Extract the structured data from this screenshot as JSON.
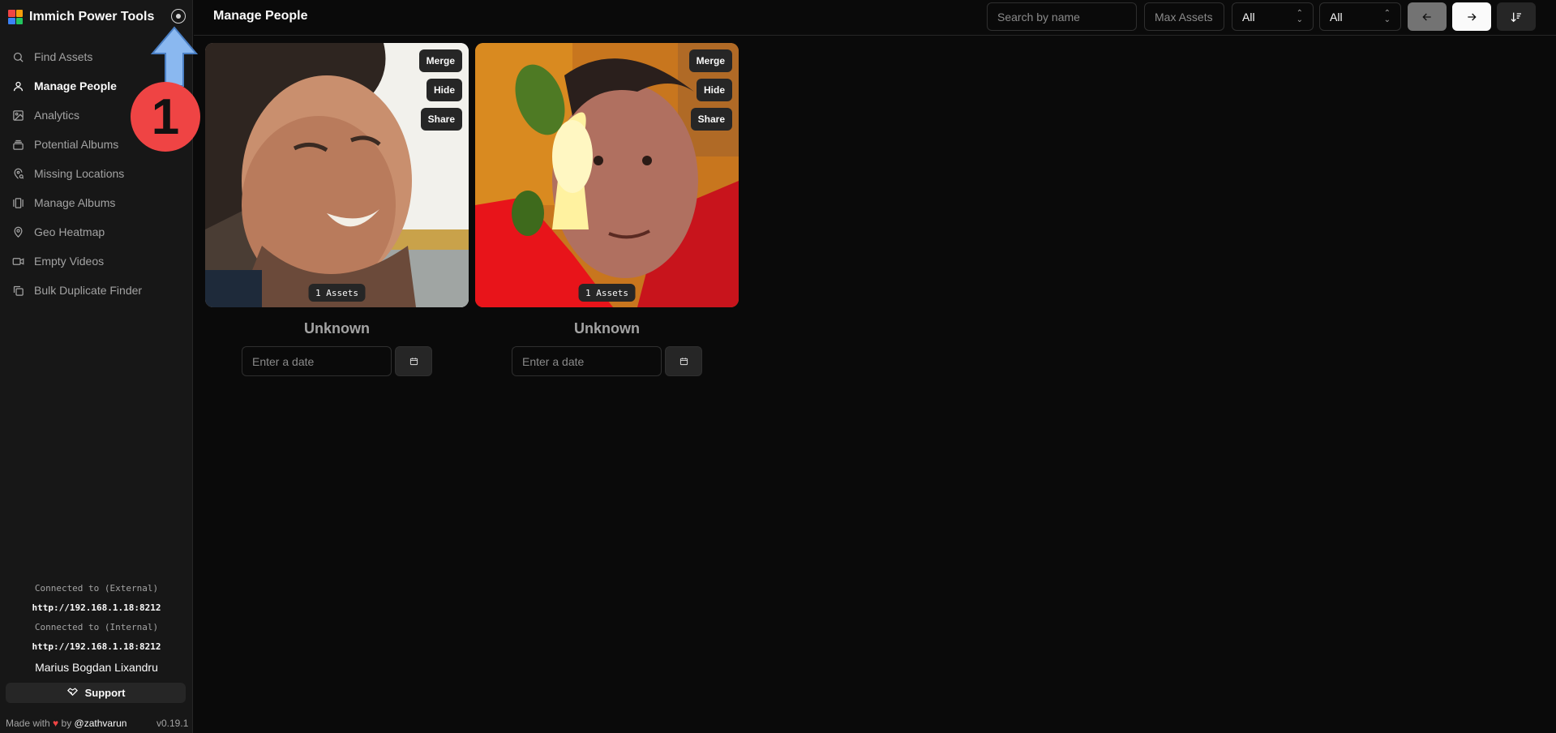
{
  "app": {
    "title": "Immich Power Tools",
    "logo_colors": [
      "#ef4444",
      "#f59e0b",
      "#3b82f6",
      "#22c55e"
    ],
    "theme_toggle_icon": "sun-moon-icon"
  },
  "sidebar": {
    "items": [
      {
        "label": "Find Assets",
        "icon": "search-icon",
        "active": false
      },
      {
        "label": "Manage People",
        "icon": "user-icon",
        "active": true
      },
      {
        "label": "Analytics",
        "icon": "image-chart-icon",
        "active": false
      },
      {
        "label": "Potential Albums",
        "icon": "album-stack-icon",
        "active": false
      },
      {
        "label": "Missing Locations",
        "icon": "location-search-icon",
        "active": false
      },
      {
        "label": "Manage Albums",
        "icon": "albums-icon",
        "active": false
      },
      {
        "label": "Geo Heatmap",
        "icon": "map-pin-icon",
        "active": false
      },
      {
        "label": "Empty Videos",
        "icon": "video-icon",
        "active": false
      },
      {
        "label": "Bulk Duplicate Finder",
        "icon": "copy-icon",
        "active": false
      }
    ],
    "connection": {
      "external_label": "Connected to (External)",
      "external_url": "http://192.168.1.18:8212",
      "internal_label": "Connected to (Internal)",
      "internal_url": "http://192.168.1.18:8212"
    },
    "user_name": "Marius Bogdan Lixandru",
    "support_label": "Support",
    "made_with_prefix": "Made with",
    "made_with_heart": "♥",
    "made_with_by": "by",
    "made_with_author": "@zathvarun",
    "version": "v0.19.1"
  },
  "annotation": {
    "number": "1",
    "arrow_color": "#8ab8f0",
    "circle_color": "#ef4444"
  },
  "header": {
    "title": "Manage People",
    "search_placeholder": "Search by name",
    "max_assets_placeholder": "Max Assets",
    "filter1_value": "All",
    "filter2_value": "All",
    "prev_icon": "arrow-left-icon",
    "next_icon": "arrow-right-icon",
    "sort_icon": "sort-icon"
  },
  "people": [
    {
      "name": "Unknown",
      "assets_label": "1 Assets",
      "merge_label": "Merge",
      "hide_label": "Hide",
      "share_label": "Share",
      "date_placeholder": "Enter a date"
    },
    {
      "name": "Unknown",
      "assets_label": "1 Assets",
      "merge_label": "Merge",
      "hide_label": "Hide",
      "share_label": "Share",
      "date_placeholder": "Enter a date"
    }
  ]
}
